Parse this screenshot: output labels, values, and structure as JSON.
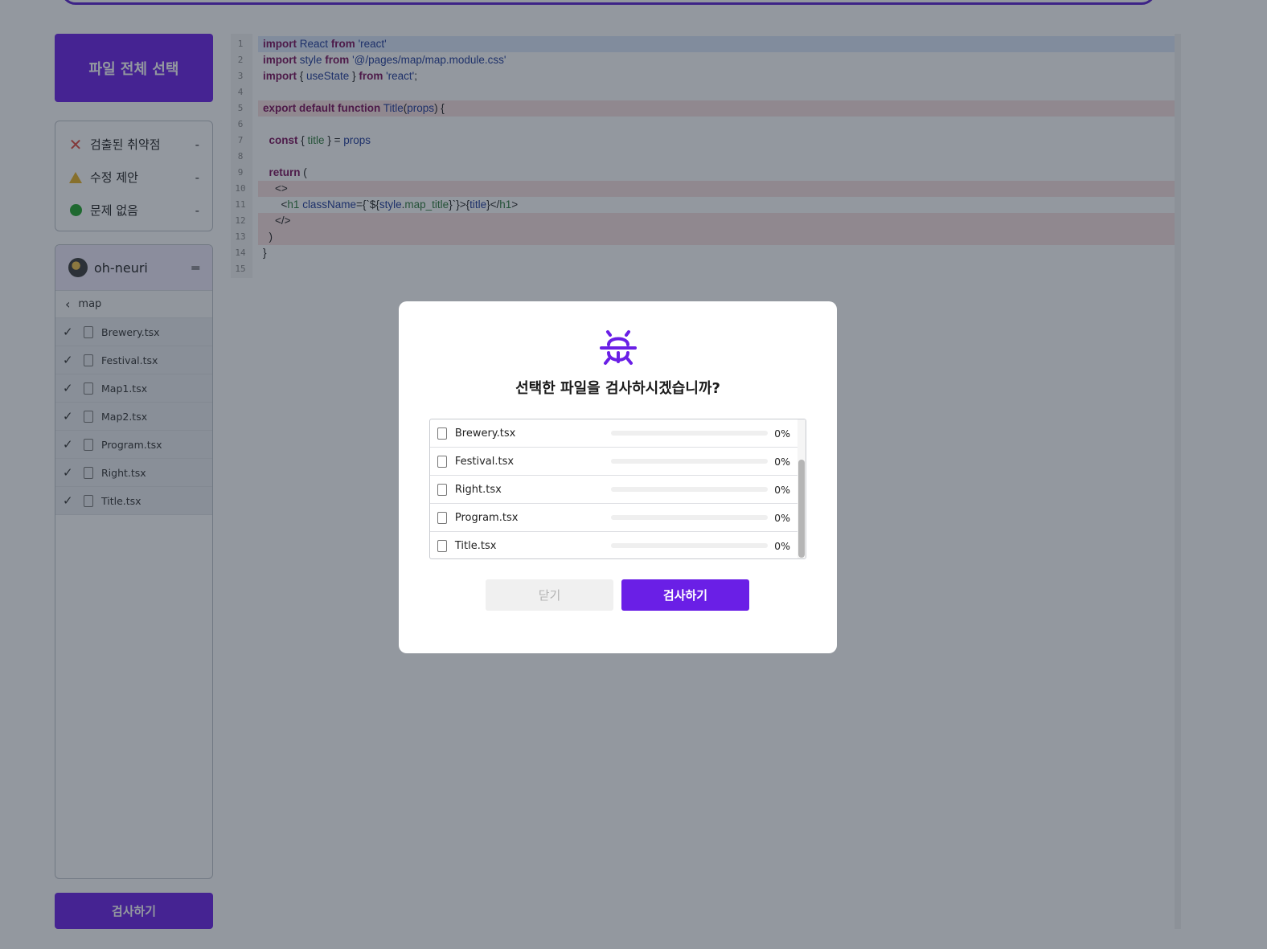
{
  "sidebar": {
    "select_all_label": "파일 전체 선택",
    "legend": [
      {
        "label": "검출된 취약점",
        "count": "-",
        "icon": "x-icon",
        "color": "#e0493f"
      },
      {
        "label": "수정 제안",
        "count": "-",
        "icon": "warning-triangle-icon",
        "color": "#e8b324"
      },
      {
        "label": "문제 없음",
        "count": "-",
        "icon": "ok-dot-icon",
        "color": "#22a52b"
      }
    ],
    "user": "oh-neuri",
    "folder": "map",
    "files": [
      "Brewery.tsx",
      "Festival.tsx",
      "Map1.tsx",
      "Map2.tsx",
      "Program.tsx",
      "Right.tsx",
      "Title.tsx"
    ],
    "scan_label": "검사하기"
  },
  "code": {
    "line_numbers": [
      "1",
      "2",
      "3",
      "4",
      "5",
      "6",
      "7",
      "8",
      "9",
      "10",
      "11",
      "12",
      "13",
      "14",
      "15"
    ]
  },
  "modal": {
    "title": "선택한 파일을 검사하시겠습니까?",
    "files": [
      {
        "name": "Brewery.tsx",
        "progress": "0%"
      },
      {
        "name": "Festival.tsx",
        "progress": "0%"
      },
      {
        "name": "Right.tsx",
        "progress": "0%"
      },
      {
        "name": "Program.tsx",
        "progress": "0%"
      },
      {
        "name": "Title.tsx",
        "progress": "0%"
      }
    ],
    "close_label": "닫기",
    "scan_label": "검사하기"
  },
  "colors": {
    "accent": "#6a1fe6",
    "error": "#e0493f",
    "warning": "#e8b324",
    "ok": "#22a52b"
  }
}
